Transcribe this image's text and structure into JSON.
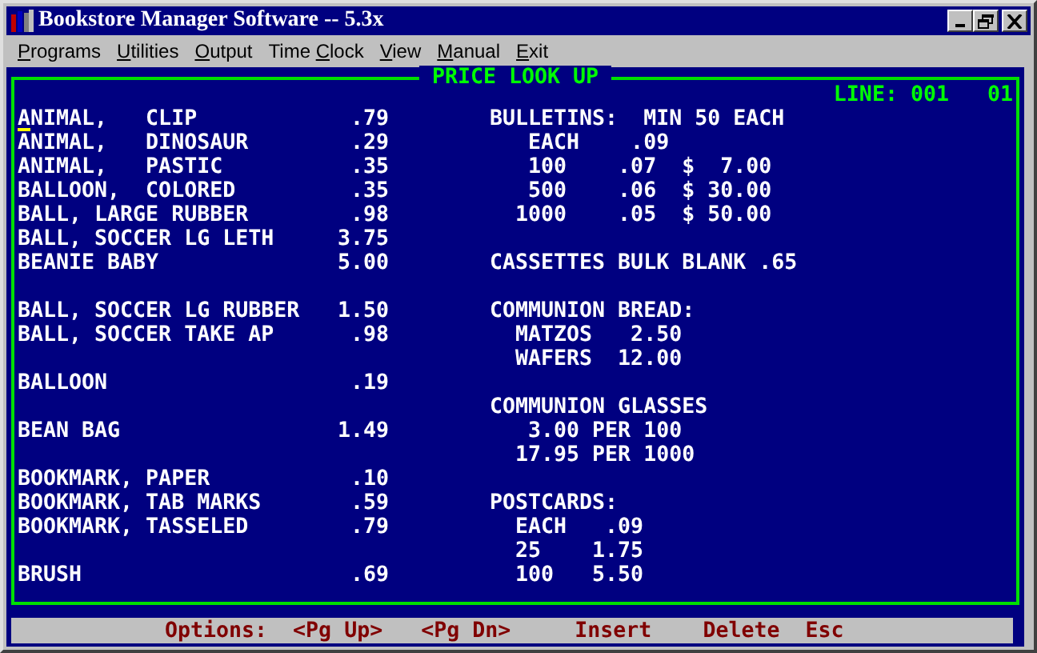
{
  "window": {
    "title": "Bookstore Manager Software -- 5.3x"
  },
  "menu": [
    {
      "hotkey": "P",
      "after": "rograms"
    },
    {
      "hotkey": "U",
      "after": "tilities"
    },
    {
      "hotkey": "O",
      "after": "utput"
    },
    {
      "before": "Time ",
      "hotkey": "C",
      "after": "lock"
    },
    {
      "hotkey": "V",
      "after": "iew"
    },
    {
      "hotkey": "M",
      "after": "anual"
    },
    {
      "hotkey": "E",
      "after": "xit"
    }
  ],
  "panel": {
    "title": "PRICE LOOK UP",
    "line_indicator": "LINE: 001   01"
  },
  "left_groups": [
    [
      {
        "name": "ANIMAL,   CLIP",
        "price": ".79",
        "cursor": true
      },
      {
        "name": "ANIMAL,   DINOSAUR",
        "price": ".29",
        "cursor": false
      },
      {
        "name": "ANIMAL,   PASTIC",
        "price": ".35",
        "cursor": false
      },
      {
        "name": "BALLOON,  COLORED",
        "price": ".35",
        "cursor": false
      },
      {
        "name": "BALL, LARGE RUBBER",
        "price": ".98",
        "cursor": false
      },
      {
        "name": "BALL, SOCCER LG LETH",
        "price": "3.75",
        "cursor": false
      },
      {
        "name": "BEANIE BABY",
        "price": "5.00",
        "cursor": false
      }
    ],
    [
      {
        "name": "BALL, SOCCER LG RUBBER",
        "price": "1.50",
        "cursor": false
      },
      {
        "name": "BALL, SOCCER TAKE AP",
        "price": ".98",
        "cursor": false
      }
    ],
    [
      {
        "name": "BALLOON",
        "price": ".19",
        "cursor": false
      }
    ],
    [
      {
        "name": "BEAN BAG",
        "price": "1.49",
        "cursor": false
      }
    ],
    [
      {
        "name": "BOOKMARK, PAPER",
        "price": ".10",
        "cursor": false
      },
      {
        "name": "BOOKMARK, TAB MARKS",
        "price": ".59",
        "cursor": false
      },
      {
        "name": "BOOKMARK, TASSELED",
        "price": ".79",
        "cursor": false
      }
    ],
    [
      {
        "name": "BRUSH",
        "price": ".69",
        "cursor": false
      }
    ]
  ],
  "right_groups": [
    [
      "BULLETINS:  MIN 50 EACH",
      "   EACH    .09",
      "   100    .07  $  7.00",
      "   500    .06  $ 30.00",
      "  1000    .05  $ 50.00"
    ],
    [
      "CASSETTES BULK BLANK .65"
    ],
    [
      "COMMUNION BREAD:",
      "  MATZOS   2.50",
      "  WAFERS  12.00"
    ],
    [
      "COMMUNION GLASSES",
      "   3.00 PER 100",
      "  17.95 PER 1000"
    ],
    [
      "POSTCARDS:",
      "  EACH   .09",
      "  25    1.75",
      "  100   5.50"
    ]
  ],
  "options_bar": {
    "label": "Options:",
    "keys": [
      "<Pg Up>",
      "<Pg Dn>",
      "Insert",
      "Delete",
      "Esc"
    ]
  }
}
